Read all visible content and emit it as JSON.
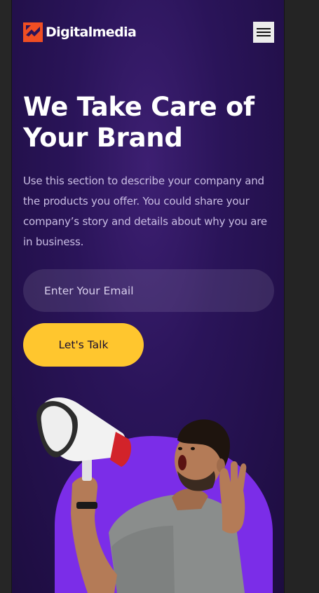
{
  "brand": {
    "name": "Digitalmedia",
    "logo_color": "#f04e23"
  },
  "hero": {
    "title_line1": "We Take Care of",
    "title_line2": "Your Brand",
    "description": "Use this section to describe your company and the products you offer. You could share your company’s story and details about why you are in business."
  },
  "form": {
    "email_placeholder": "Enter Your Email",
    "cta_label": "Let's Talk"
  },
  "icons": {
    "menu": "hamburger-menu-icon",
    "logo": "diamond-arrow-logo-icon"
  },
  "colors": {
    "background": "#2a1459",
    "accent": "#ffc62e",
    "circle": "#7b2de8"
  }
}
